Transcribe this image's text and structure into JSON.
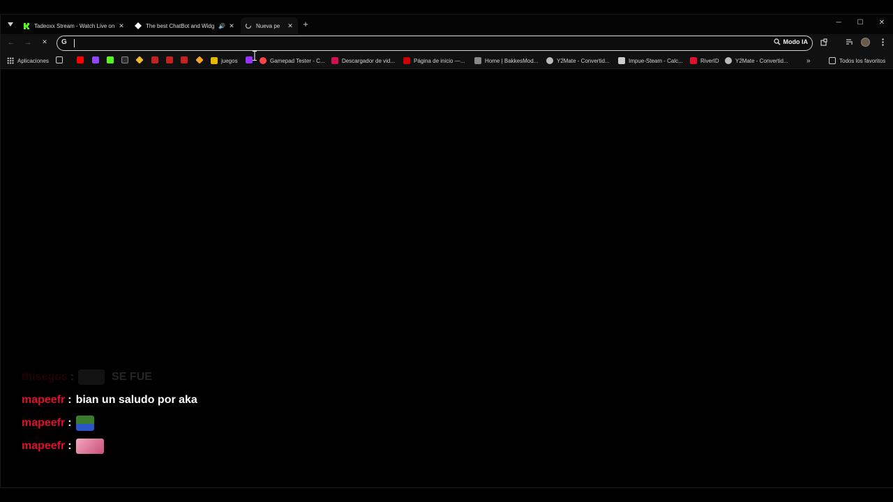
{
  "tabs": [
    {
      "title": "Tadeoxx Stream - Watch Live on",
      "favicon": "kick-icon",
      "color": "#53fc18"
    },
    {
      "title": "The best ChatBot and Widg",
      "favicon": "streamelements-icon",
      "color": "#ffffff",
      "audio": "🔊"
    },
    {
      "title": "Nueva pe",
      "favicon": "loading-icon",
      "color": "#aaaaaa"
    }
  ],
  "tab_close": "✕",
  "new_tab": "+",
  "window_controls": {
    "minimize": "─",
    "maximize": "☐",
    "close": "✕"
  },
  "omnibox": {
    "value": "",
    "placeholder": "",
    "ai_mode": "Modo IA",
    "engine_icon": "G"
  },
  "nav": {
    "back": "←",
    "forward": "→",
    "reload": "✕"
  },
  "bookmarks": {
    "apps": "Aplicaciones",
    "items": [
      {
        "label": "juegos",
        "color": "#e6b800"
      },
      {
        "label": "Gamepad Tester - C...",
        "color": "#ff4444"
      },
      {
        "label": "Descargador de vid...",
        "color": "#d0104c"
      },
      {
        "label": "Página de inicio —...",
        "color": "#cc0000"
      },
      {
        "label": "Home | BakkesMod...",
        "color": "#888888"
      },
      {
        "label": "Y2Mate - Convertid...",
        "color": "#bbbbbb"
      },
      {
        "label": "Impue-Steam - Calc...",
        "color": "#cccccc"
      },
      {
        "label": "RiverID",
        "color": "#e0102d"
      },
      {
        "label": "Y2Mate - Convertid...",
        "color": "#bbbbbb"
      }
    ],
    "all_favorites": "Todos los favoritos",
    "overflow": "»"
  },
  "chat": [
    {
      "user": "thisegos",
      "colon": ":",
      "message": "SE FUE",
      "emote": "emote-image",
      "faded": true
    },
    {
      "user": "mapeefr",
      "colon": ":",
      "message": "bian un saludo por aka",
      "faded": false
    },
    {
      "user": "mapeefr",
      "colon": ":",
      "message": "",
      "emote": "pepe-emote",
      "faded": false
    },
    {
      "user": "mapeefr",
      "colon": ":",
      "message": "",
      "emote": "pink-emote",
      "faded": false
    }
  ],
  "colors": {
    "accent_red": "#e0102d",
    "background": "#000000",
    "toolbar": "#111111"
  }
}
